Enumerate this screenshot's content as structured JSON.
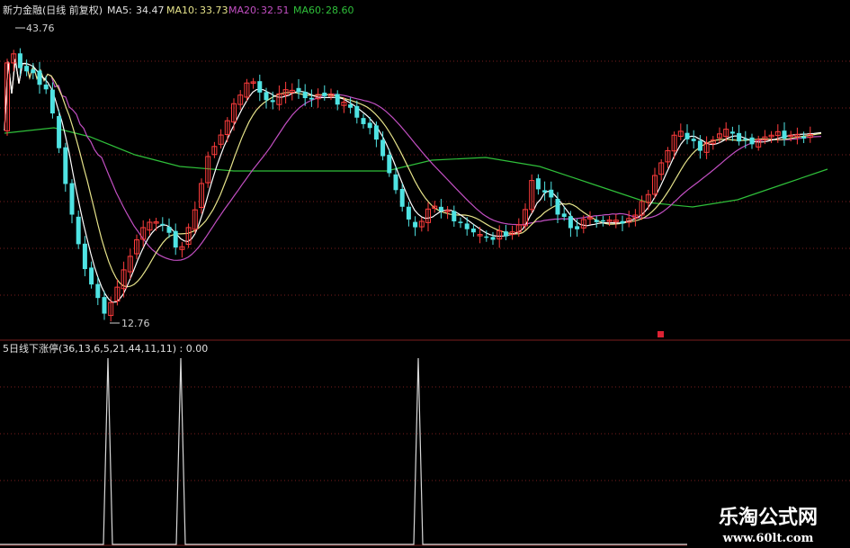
{
  "main_panel": {
    "header": {
      "name": "新力金融(日线 前复权)",
      "ma5_label": "MA5:",
      "ma5_value": "34.47",
      "ma10_label": "MA10:",
      "ma10_value": "33.73",
      "ma20_label": "MA20:",
      "ma20_value": "32.51",
      "ma60_label": "MA60:",
      "ma60_value": "28.60"
    },
    "high_label": "43.76",
    "low_label": "12.76",
    "colors": {
      "up": "#ff3c3c",
      "down": "#4fe3e3",
      "ma5": "#ffffff",
      "ma10": "#e6e38a",
      "ma20": "#c24fc2",
      "ma60": "#2fbf3a",
      "grid": "#7a1e1e"
    }
  },
  "indicator_panel": {
    "title": "5日线下涨停(36,13,6,5,21,44,11,11) : 0.00",
    "spike_count": 3
  },
  "watermark": {
    "line1": "乐淘公式网",
    "line2": "www.60lt.com"
  },
  "chart_data": [
    {
      "type": "candlestick",
      "title": "新力金融(日线 前复权)",
      "y_range": [
        12.76,
        43.76
      ],
      "high": 43.76,
      "low": 12.76,
      "series": [
        {
          "name": "MA5",
          "last": 34.47
        },
        {
          "name": "MA10",
          "last": 33.73
        },
        {
          "name": "MA20",
          "last": 32.51
        },
        {
          "name": "MA60",
          "last": 28.6
        }
      ]
    },
    {
      "type": "line",
      "title": "5日线下涨停(36,13,6,5,21,44,11,11) : 0.00",
      "signal_indices": [
        0,
        1,
        2
      ],
      "y_range": [
        0,
        1
      ]
    }
  ]
}
